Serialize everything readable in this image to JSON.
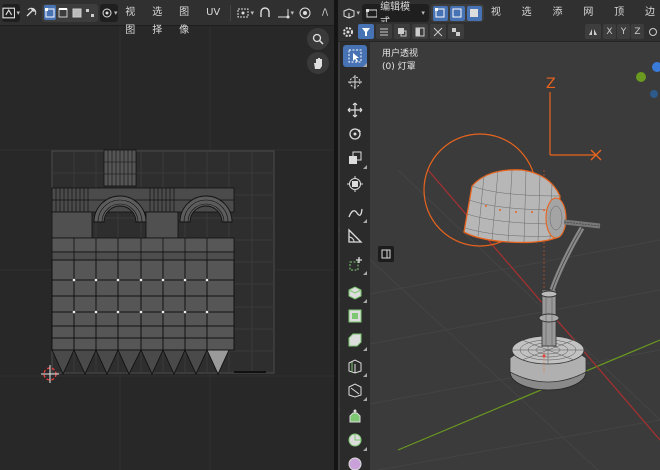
{
  "uv_editor": {
    "header": {
      "editor_type_icon": "uv-editor-icon",
      "sync_icon": "uv-sync-icon",
      "select_modes": [
        "vertex-select-icon",
        "edge-select-icon",
        "face-select-icon",
        "island-select-icon"
      ],
      "sticky_icon": "sticky-select-icon",
      "menus": [
        "视图",
        "选择",
        "图像",
        "UV"
      ],
      "pivot_icon": "pivot-point-icon",
      "snap_icon": "snap-icon",
      "proportional_icon": "proportional-edit-icon",
      "overlay_icon": "overlay-icon",
      "more_label": "/\\"
    },
    "nav": {
      "zoom_icon": "zoom-icon",
      "pan_icon": "pan-hand-icon"
    }
  },
  "viewport": {
    "header": {
      "editor_type_icon": "3d-viewport-icon",
      "mode_label": "编辑模式",
      "select_modes": [
        "vertex-select-icon",
        "edge-select-icon",
        "face-select-icon"
      ],
      "menus": [
        "视图",
        "选择",
        "添加",
        "网格",
        "顶点",
        "边"
      ]
    },
    "header2": {
      "settings_icon": "gear-icon",
      "filter_icon": "filter-icon",
      "mirror_axes": [
        "X",
        "Y",
        "Z"
      ]
    },
    "overlay": {
      "view_name": "用户透视",
      "object_name": "(0) 灯罩"
    },
    "axis_label": "Z",
    "sidebar_tab_icon": "sidebar-toggle-icon",
    "tools": [
      {
        "name": "select-box-tool",
        "icon": "select-box-icon",
        "active": true
      },
      {
        "name": "cursor-tool",
        "icon": "cursor-icon",
        "active": false
      },
      {
        "name": "move-tool",
        "icon": "move-icon",
        "active": false
      },
      {
        "name": "rotate-tool",
        "icon": "rotate-icon",
        "active": false
      },
      {
        "name": "scale-tool",
        "icon": "scale-icon",
        "active": false
      },
      {
        "name": "transform-tool",
        "icon": "transform-icon",
        "active": false
      },
      {
        "name": "annotate-tool",
        "icon": "annotate-icon",
        "active": false
      },
      {
        "name": "measure-tool",
        "icon": "measure-icon",
        "active": false
      },
      {
        "name": "add-cube-tool",
        "icon": "add-cube-icon",
        "active": false
      },
      {
        "name": "extrude-tool",
        "icon": "extrude-icon",
        "active": false
      },
      {
        "name": "inset-tool",
        "icon": "inset-faces-icon",
        "active": false
      },
      {
        "name": "bevel-tool",
        "icon": "bevel-icon",
        "active": false
      },
      {
        "name": "loop-cut-tool",
        "icon": "loop-cut-icon",
        "active": false
      },
      {
        "name": "knife-tool",
        "icon": "knife-icon",
        "active": false
      },
      {
        "name": "poly-build-tool",
        "icon": "poly-build-icon",
        "active": false
      },
      {
        "name": "spin-tool",
        "icon": "spin-icon",
        "active": false
      },
      {
        "name": "smooth-tool",
        "icon": "smooth-icon",
        "active": false
      }
    ]
  },
  "colors": {
    "accent": "#4772b3",
    "selection_orange": "#e8641e",
    "axis_red": "#d43c3c",
    "axis_green": "#6a9a1f",
    "uv_background": "#282828",
    "viewport_background": "#3b3b3b"
  }
}
